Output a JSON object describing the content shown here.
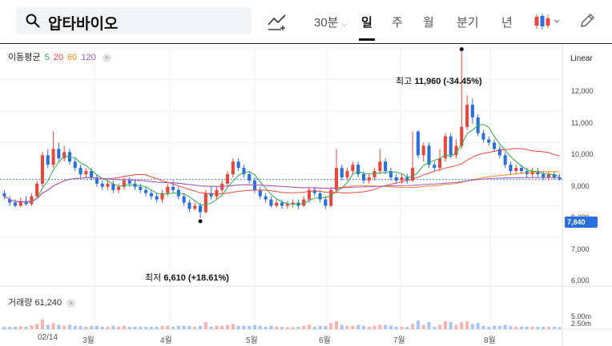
{
  "search": {
    "query": "압타바이오"
  },
  "periods": [
    "30분",
    "일",
    "주",
    "월",
    "분기",
    "년"
  ],
  "selected_period": "일",
  "chart_data": {
    "type": "candlestick",
    "scale": "Linear",
    "ma_label": "이동평균",
    "ma_periods": [
      {
        "label": "5",
        "color": "#2fa84f"
      },
      {
        "label": "20",
        "color": "#e84b3c"
      },
      {
        "label": "60",
        "color": "#f28a1e"
      },
      {
        "label": "120",
        "color": "#9b59d0"
      }
    ],
    "up_color": "#e8473d",
    "down_color": "#2a6fdb",
    "y_ticks": [
      "12,000",
      "11,000",
      "10,000",
      "9,000",
      "8,000",
      "7,000",
      "6,000"
    ],
    "ylim": [
      6000,
      12500
    ],
    "x_ticks": [
      "02/14",
      "3월",
      "4월",
      "5월",
      "6월",
      "7월",
      "8월"
    ],
    "current_price": "7,840",
    "high_label": "최고",
    "high_value": "11,960",
    "high_change": "(-34.45%)",
    "low_label": "최저",
    "low_value": "6,610",
    "low_change": "(+18.61%)",
    "volume_label": "거래량",
    "volume_value": "61,240",
    "volume_ticks": [
      "5.00m",
      "2.50m"
    ]
  }
}
